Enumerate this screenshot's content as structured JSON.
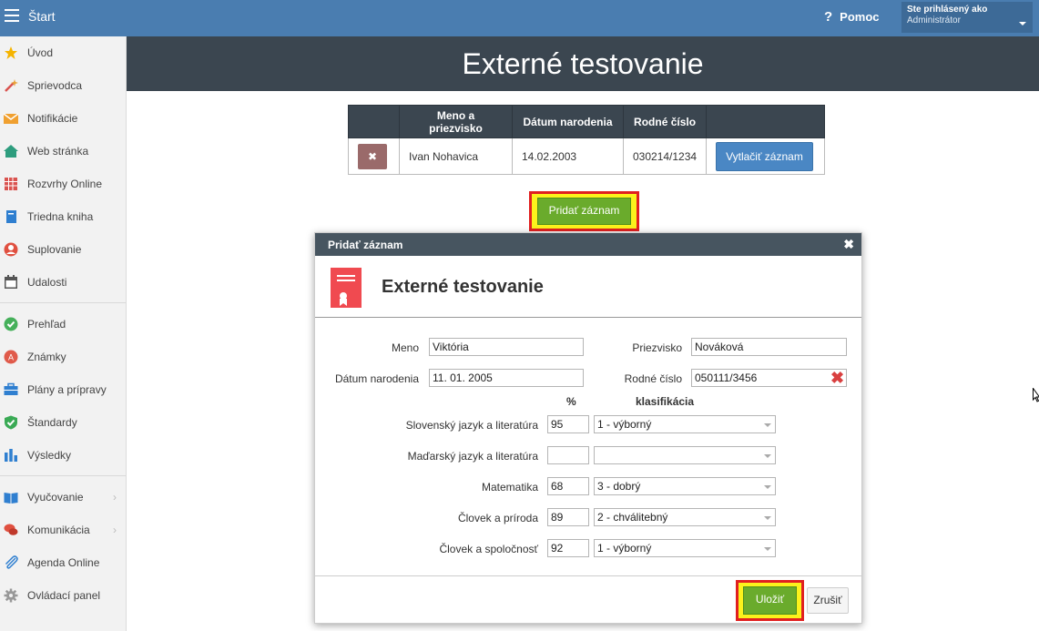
{
  "topbar": {
    "title": "Štart",
    "help_label": "Pomoc",
    "user_line1": "Ste prihlásený ako",
    "user_line2": "Administrátor"
  },
  "sidebar": {
    "items": [
      {
        "label": "Úvod",
        "icon": "star-icon"
      },
      {
        "label": "Sprievodca",
        "icon": "magic-wand-icon"
      },
      {
        "label": "Notifikácie",
        "icon": "envelope-icon"
      },
      {
        "label": "Web stránka",
        "icon": "home-icon"
      },
      {
        "label": "Rozvrhy Online",
        "icon": "calendar-grid-icon"
      },
      {
        "label": "Triedna kniha",
        "icon": "book-icon"
      },
      {
        "label": "Suplovanie",
        "icon": "person-icon"
      },
      {
        "label": "Udalosti",
        "icon": "calendar-icon"
      },
      {
        "label": "Prehľad",
        "icon": "check-circle-icon"
      },
      {
        "label": "Známky",
        "icon": "grade-icon"
      },
      {
        "label": "Plány a prípravy",
        "icon": "briefcase-icon"
      },
      {
        "label": "Štandardy",
        "icon": "shield-check-icon"
      },
      {
        "label": "Výsledky",
        "icon": "bar-chart-icon"
      },
      {
        "label": "Vyučovanie",
        "icon": "open-book-icon"
      },
      {
        "label": "Komunikácia",
        "icon": "chat-icon"
      },
      {
        "label": "Agenda Online",
        "icon": "paperclip-icon"
      },
      {
        "label": "Ovládací panel",
        "icon": "gear-icon"
      }
    ]
  },
  "page": {
    "title": "Externé testovanie"
  },
  "table": {
    "headers": [
      "",
      "Meno a priezvisko",
      "Dátum narodenia",
      "Rodné číslo",
      ""
    ],
    "rows": [
      {
        "delete": "✖",
        "name": "Ivan Nohavica",
        "birth_date": "14.02.2003",
        "birth_number": "030214/1234",
        "print_label": "Vytlačiť záznam"
      }
    ]
  },
  "add_record_label": "Pridať záznam",
  "dialog": {
    "title": "Pridať záznam",
    "close": "✖",
    "heading": "Externé testovanie",
    "fields": {
      "first_name_label": "Meno",
      "first_name_value": "Viktória",
      "last_name_label": "Priezvisko",
      "last_name_value": "Nováková",
      "birth_date_label": "Dátum narodenia",
      "birth_date_value": "11. 01. 2005",
      "birth_number_label": "Rodné číslo",
      "birth_number_value": "050111/3456"
    },
    "col_percent": "%",
    "col_grade": "klasifikácia",
    "subjects": [
      {
        "name": "Slovenský jazyk a literatúra",
        "percent": "95",
        "grade": "1 - výborný"
      },
      {
        "name": "Maďarský jazyk a literatúra",
        "percent": "",
        "grade": ""
      },
      {
        "name": "Matematika",
        "percent": "68",
        "grade": "3 - dobrý"
      },
      {
        "name": "Človek a príroda",
        "percent": "89",
        "grade": "2 - chválitebný"
      },
      {
        "name": "Človek a spoločnosť",
        "percent": "92",
        "grade": "1 - výborný"
      }
    ],
    "save_label": "Uložiť",
    "cancel_label": "Zrušiť"
  },
  "colors": {
    "topbar": "#4a7db0",
    "header": "#3b4650",
    "green_button": "#6aab2c",
    "highlight": "#fbf21c",
    "highlight_border": "#e02020",
    "print_button": "#4a87c4"
  }
}
